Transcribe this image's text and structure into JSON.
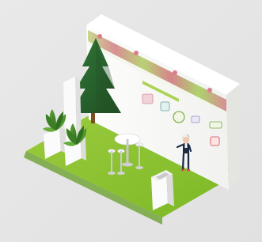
{
  "scene": {
    "background": "#e6e6e6",
    "floor_green": "#88c12a",
    "wall_white": "#f8f8f6",
    "accent_green": "#8fbe33",
    "banner_pink": "#d78a91"
  },
  "booth": {
    "wall_heading": "",
    "logos": [
      "pink-logo",
      "teal-logo",
      "green-logo",
      "lavender-logo",
      "green-wordmark-logo",
      "red-logo"
    ]
  },
  "icons": [
    "tree-icon",
    "plant-icon",
    "table-icon",
    "stool-icon",
    "person-icon",
    "counter-icon"
  ]
}
